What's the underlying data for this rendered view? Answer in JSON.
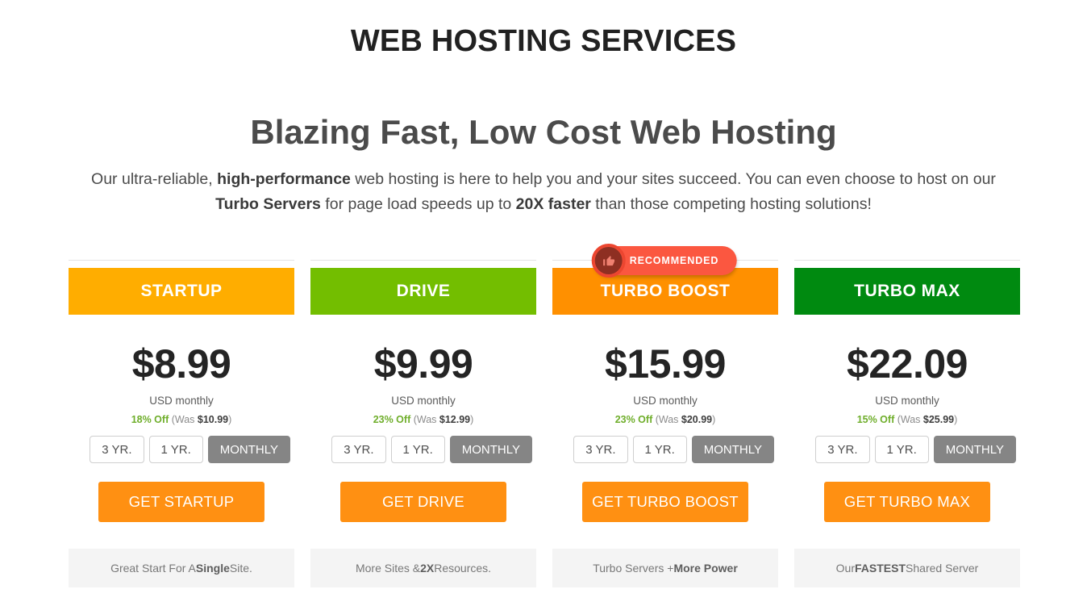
{
  "header": {
    "eyebrow_title": "WEB HOSTING SERVICES",
    "hero_title": "Blazing Fast, Low Cost Web Hosting",
    "description": {
      "line1_part1": "Our ultra-reliable, ",
      "line1_bold1": "high-performance",
      "line1_part2": " web hosting is here to help you and your sites succeed. You can even choose to host on our ",
      "line1_bold2": "Turbo Servers",
      "line1_part3": " for page load speeds up to ",
      "line1_bold3": "20X faster",
      "line1_part4": " than those competing hosting solutions!"
    }
  },
  "badge": {
    "label": "RECOMMENDED",
    "icon": "thumbs-up-icon",
    "color": "#fb5740"
  },
  "terms": {
    "three_year": "3 YR.",
    "one_year": "1 YR.",
    "monthly": "MONTHLY",
    "selected": "MONTHLY"
  },
  "labels": {
    "usd_monthly": "USD monthly",
    "was_prefix": "(Was ",
    "was_suffix": ")"
  },
  "colors": {
    "startup": "#ffad00",
    "drive": "#73be00",
    "turbo_boost": "#ff9000",
    "turbo_max": "#008a10",
    "cta": "#ff9012",
    "discount_green": "#6fae2b",
    "term_selected": "#858585"
  },
  "plans": [
    {
      "name": "STARTUP",
      "header_color": "#ffad00",
      "price": "$8.99",
      "unit": "USD monthly",
      "discount_percent": "18% Off",
      "was_price": "$10.99",
      "cta_label": "GET STARTUP",
      "footer_pre": "Great Start For A ",
      "footer_bold": "Single",
      "footer_post": " Site.",
      "recommended": false
    },
    {
      "name": "DRIVE",
      "header_color": "#73be00",
      "price": "$9.99",
      "unit": "USD monthly",
      "discount_percent": "23% Off",
      "was_price": "$12.99",
      "cta_label": "GET DRIVE",
      "footer_pre": "More Sites & ",
      "footer_bold": "2X",
      "footer_post": " Resources.",
      "recommended": false
    },
    {
      "name": "TURBO BOOST",
      "header_color": "#ff9000",
      "price": "$15.99",
      "unit": "USD monthly",
      "discount_percent": "23% Off",
      "was_price": "$20.99",
      "cta_label": "GET TURBO BOOST",
      "footer_pre": "Turbo Servers + ",
      "footer_bold": "More Power",
      "footer_post": "",
      "recommended": true
    },
    {
      "name": "TURBO MAX",
      "header_color": "#008a10",
      "price": "$22.09",
      "unit": "USD monthly",
      "discount_percent": "15% Off",
      "was_price": "$25.99",
      "cta_label": "GET TURBO MAX",
      "footer_pre": "Our ",
      "footer_bold": "FASTEST",
      "footer_post": " Shared Server",
      "recommended": false
    }
  ]
}
